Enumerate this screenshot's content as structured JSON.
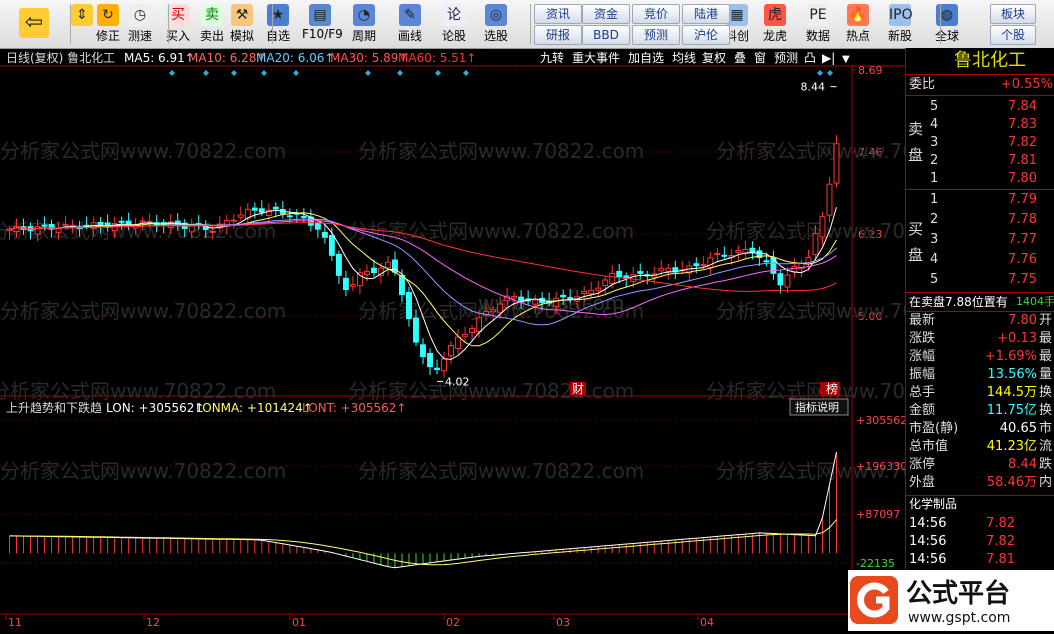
{
  "toolbar": {
    "buttons": [
      {
        "label": "",
        "icon": "back-arrow-icon"
      },
      {
        "label": "",
        "icon": "up-down-arrow-icon"
      },
      {
        "label": "修正",
        "icon": "correct-icon"
      },
      {
        "label": "测速",
        "icon": "clock-icon"
      },
      {
        "label": "买入",
        "icon": "buy-icon"
      },
      {
        "label": "卖出",
        "icon": "sell-icon"
      },
      {
        "label": "模拟",
        "icon": "hammer-icon"
      },
      {
        "label": "自选",
        "icon": "star-icon"
      },
      {
        "label": "F10/F9",
        "icon": "f10-icon"
      },
      {
        "label": "周期",
        "icon": "period-icon"
      },
      {
        "label": "画线",
        "icon": "pencil-icon"
      },
      {
        "label": "论股",
        "icon": "discuss-icon"
      },
      {
        "label": "选股",
        "icon": "select-stock-icon"
      },
      {
        "label": "科创",
        "icon": "kechuang-icon"
      },
      {
        "label": "龙虎",
        "icon": "tiger-icon"
      },
      {
        "label": "数据",
        "icon": "pe-icon"
      },
      {
        "label": "热点",
        "icon": "hot-icon"
      },
      {
        "label": "新股",
        "icon": "ipo-icon"
      },
      {
        "label": "全球",
        "icon": "globe-icon"
      }
    ],
    "small_buttons": [
      [
        "资讯",
        "研报"
      ],
      [
        "资金",
        "BBD"
      ],
      [
        "竞价",
        "预测"
      ],
      [
        "陆港",
        "沪伦"
      ]
    ],
    "right_buttons": [
      [
        "板块",
        "个股"
      ]
    ]
  },
  "chart_header": {
    "title": "日线(复权) 鲁北化工",
    "ma5": "MA5: 6.91↑",
    "ma10": "MA10: 6.28↑",
    "ma20": "MA20: 6.06↑",
    "ma30": "MA30: 5.89↑",
    "ma60": "MA60: 5.51↑",
    "menu": [
      "九转",
      "重大事件",
      "加自选",
      "均线",
      "复权",
      "叠",
      "窗",
      "预测",
      "凸"
    ]
  },
  "price_axis": [
    "8.69",
    "7.46",
    "6.23",
    "5.00"
  ],
  "annotations": {
    "high": "8.44",
    "low": "4.02",
    "cai": "财",
    "bang": "榜"
  },
  "indicator": {
    "title": "上升趋势和下跌趋",
    "lon": "LON: +305562↑",
    "lonma": "LONMA: +101424↑",
    "lont": "LONT: +305562↑",
    "button": "指标说明",
    "axis": [
      "+305562",
      "+196330",
      "+87097",
      "-22135"
    ]
  },
  "x_axis": [
    "11",
    "12",
    "01",
    "02",
    "03",
    "04"
  ],
  "watermark": [
    "分析家公式网www.70822.com",
    "www.gspt.com"
  ],
  "stock_name": "鲁北化工",
  "quote": {
    "weibi_label": "委比",
    "weibi_value": "+0.55%",
    "sell_label": "卖盘",
    "buy_label": "买盘",
    "sell": [
      {
        "n": "5",
        "p": "7.84"
      },
      {
        "n": "4",
        "p": "7.83"
      },
      {
        "n": "3",
        "p": "7.82"
      },
      {
        "n": "2",
        "p": "7.81"
      },
      {
        "n": "1",
        "p": "7.80"
      }
    ],
    "buy": [
      {
        "n": "1",
        "p": "7.79"
      },
      {
        "n": "2",
        "p": "7.78"
      },
      {
        "n": "3",
        "p": "7.77"
      },
      {
        "n": "4",
        "p": "7.76"
      },
      {
        "n": "5",
        "p": "7.75"
      }
    ],
    "note": "在卖盘7.88位置有",
    "note_value": "1404手",
    "fields": [
      {
        "label": "最新",
        "value": "7.80",
        "extra": "开",
        "cls": "red"
      },
      {
        "label": "涨跌",
        "value": "+0.13",
        "extra": "最",
        "cls": "red"
      },
      {
        "label": "涨幅",
        "value": "+1.69%",
        "extra": "最",
        "cls": "red"
      },
      {
        "label": "振幅",
        "value": "13.56%",
        "extra": "量",
        "cls": "cyan"
      },
      {
        "label": "总手",
        "value": "144.5万",
        "extra": "换",
        "cls": "yel"
      },
      {
        "label": "金额",
        "value": "11.75亿",
        "extra": "换",
        "cls": "cyan"
      },
      {
        "label": "市盈(静)",
        "value": "40.65",
        "extra": "市",
        "cls": "wht"
      },
      {
        "label": "总市值",
        "value": "41.23亿",
        "extra": "流",
        "cls": "yel"
      },
      {
        "label": "涨停",
        "value": "8.44",
        "extra": "跌",
        "cls": "red"
      },
      {
        "label": "外盘",
        "value": "58.46万",
        "extra": "内",
        "cls": "red"
      }
    ],
    "sector": "化学制品",
    "ticks": [
      {
        "t": "14:56",
        "p": "7.82"
      },
      {
        "t": "14:56",
        "p": "7.82"
      },
      {
        "t": "14:56",
        "p": "7.81"
      }
    ]
  },
  "logo": {
    "text": "公式平台",
    "url": "www.gspt.com"
  }
}
